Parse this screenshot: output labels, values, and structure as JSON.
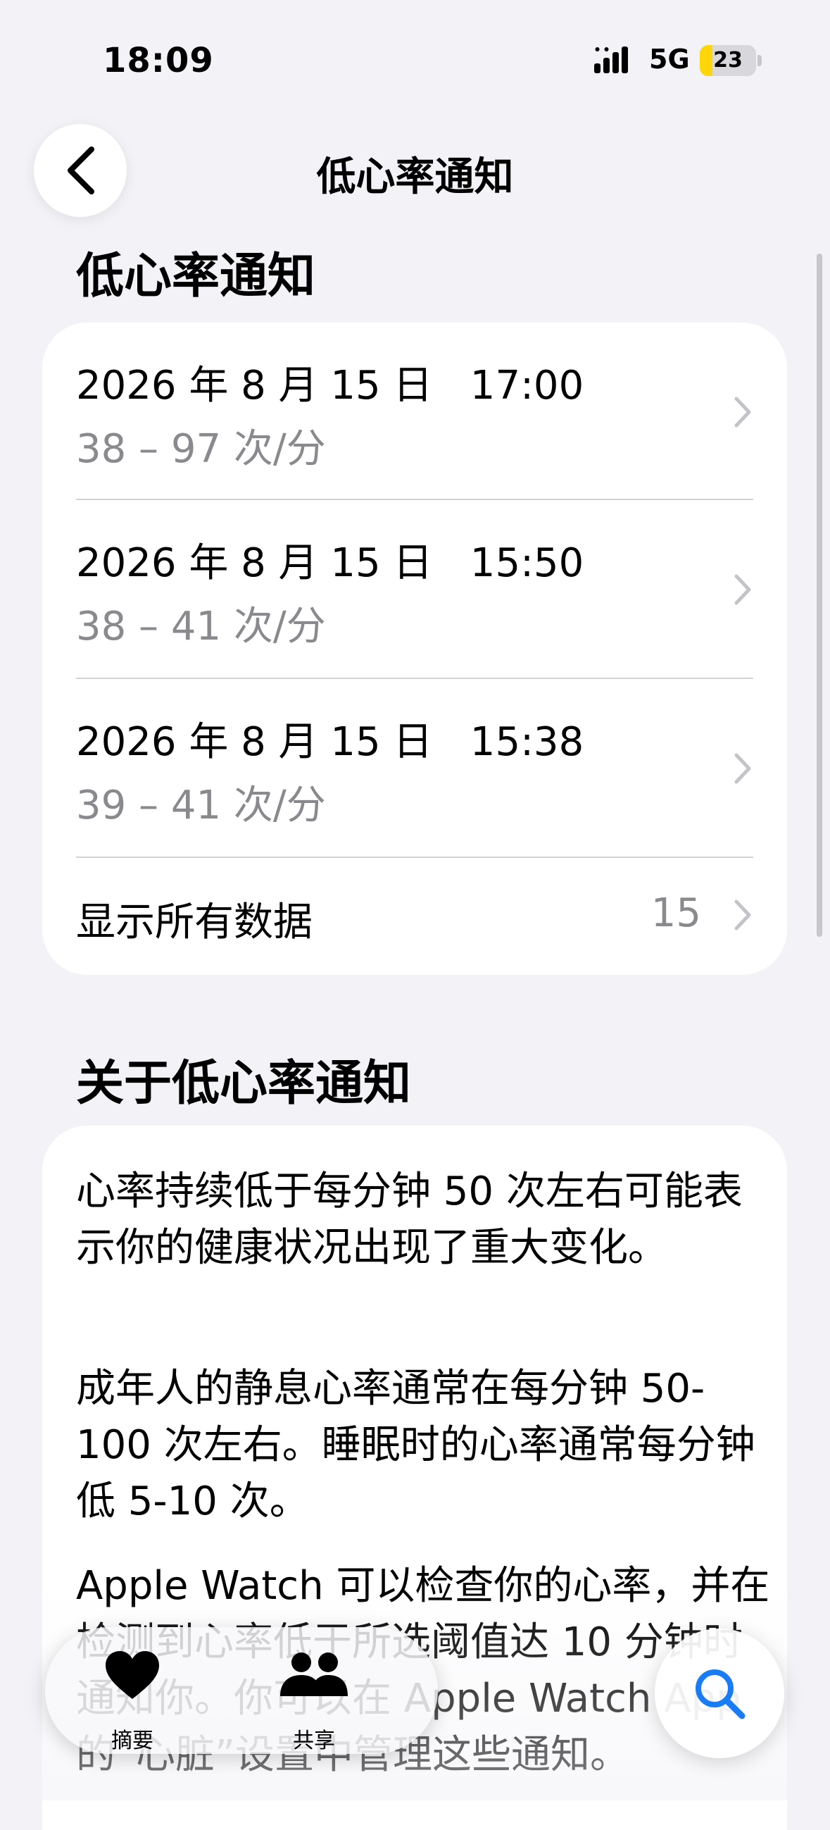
{
  "status_bar": {
    "time": "18:09",
    "network": "5G",
    "battery": "23",
    "battery_level": 0.23
  },
  "nav": {
    "title": "低心率通知"
  },
  "notifications_section": {
    "title": "低心率通知",
    "items": [
      {
        "datetime": "2026 年 8 月 15 日   17:00",
        "range": "38 – 97 次/分"
      },
      {
        "datetime": "2026 年 8 月 15 日   15:50",
        "range": "38 – 41 次/分"
      },
      {
        "datetime": "2026 年 8 月 15 日   15:38",
        "range": "39 – 41 次/分"
      }
    ],
    "show_all": {
      "label": "显示所有数据",
      "count": "15"
    }
  },
  "about_section": {
    "title": "关于低心率通知",
    "paragraphs": [
      "心率持续低于每分钟 50 次左右可能表示你的健康状况出现了重大变化。",
      "成年人的静息心率通常在每分钟 50-100 次左右。睡眠时的心率通常每分钟低 5-10 次。",
      "Apple Watch 可以检查你的心率，并在检测到心率低于所选阈值达 10 分钟时通知你。你可以在 Apple Watch App 的“心脏”设置中管理这些通知。"
    ]
  },
  "tab_bar": {
    "tabs": [
      {
        "label": "摘要",
        "icon": "heart-icon"
      },
      {
        "label": "共享",
        "icon": "people-icon"
      }
    ],
    "search_icon": "search-icon"
  },
  "colors": {
    "accent": "#1a7cf5",
    "background": "#f2f2f7",
    "secondary_text": "#8a8a8e",
    "battery": "#ffd60a"
  }
}
